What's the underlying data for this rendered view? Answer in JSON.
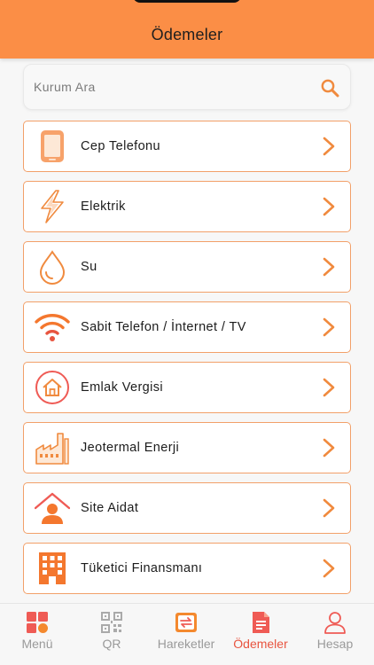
{
  "header": {
    "title": "Ödemeler"
  },
  "search": {
    "placeholder": "Kurum Ara",
    "value": ""
  },
  "categories": [
    {
      "label": "Cep Telefonu",
      "icon": "mobile-phone-icon"
    },
    {
      "label": "Elektrik",
      "icon": "lightning-icon"
    },
    {
      "label": "Su",
      "icon": "water-drop-icon"
    },
    {
      "label": "Sabit Telefon / İnternet / TV",
      "icon": "wifi-icon"
    },
    {
      "label": "Emlak Vergisi",
      "icon": "house-icon"
    },
    {
      "label": "Jeotermal Enerji",
      "icon": "factory-icon"
    },
    {
      "label": "Site Aidat",
      "icon": "home-person-icon"
    },
    {
      "label": "Tüketici Finansmanı",
      "icon": "building-icon"
    }
  ],
  "tabs": [
    {
      "label": "Menü",
      "icon": "grid-icon",
      "active": false
    },
    {
      "label": "QR",
      "icon": "qr-code-icon",
      "active": false
    },
    {
      "label": "Hareketler",
      "icon": "transactions-icon",
      "active": false
    },
    {
      "label": "Ödemeler",
      "icon": "document-icon",
      "active": true
    },
    {
      "label": "Hesap",
      "icon": "user-icon",
      "active": false
    }
  ],
  "colors": {
    "accent": "#fb8e46",
    "border": "#f2a069",
    "active": "#e8543f",
    "inactive": "#9a9a9a"
  }
}
